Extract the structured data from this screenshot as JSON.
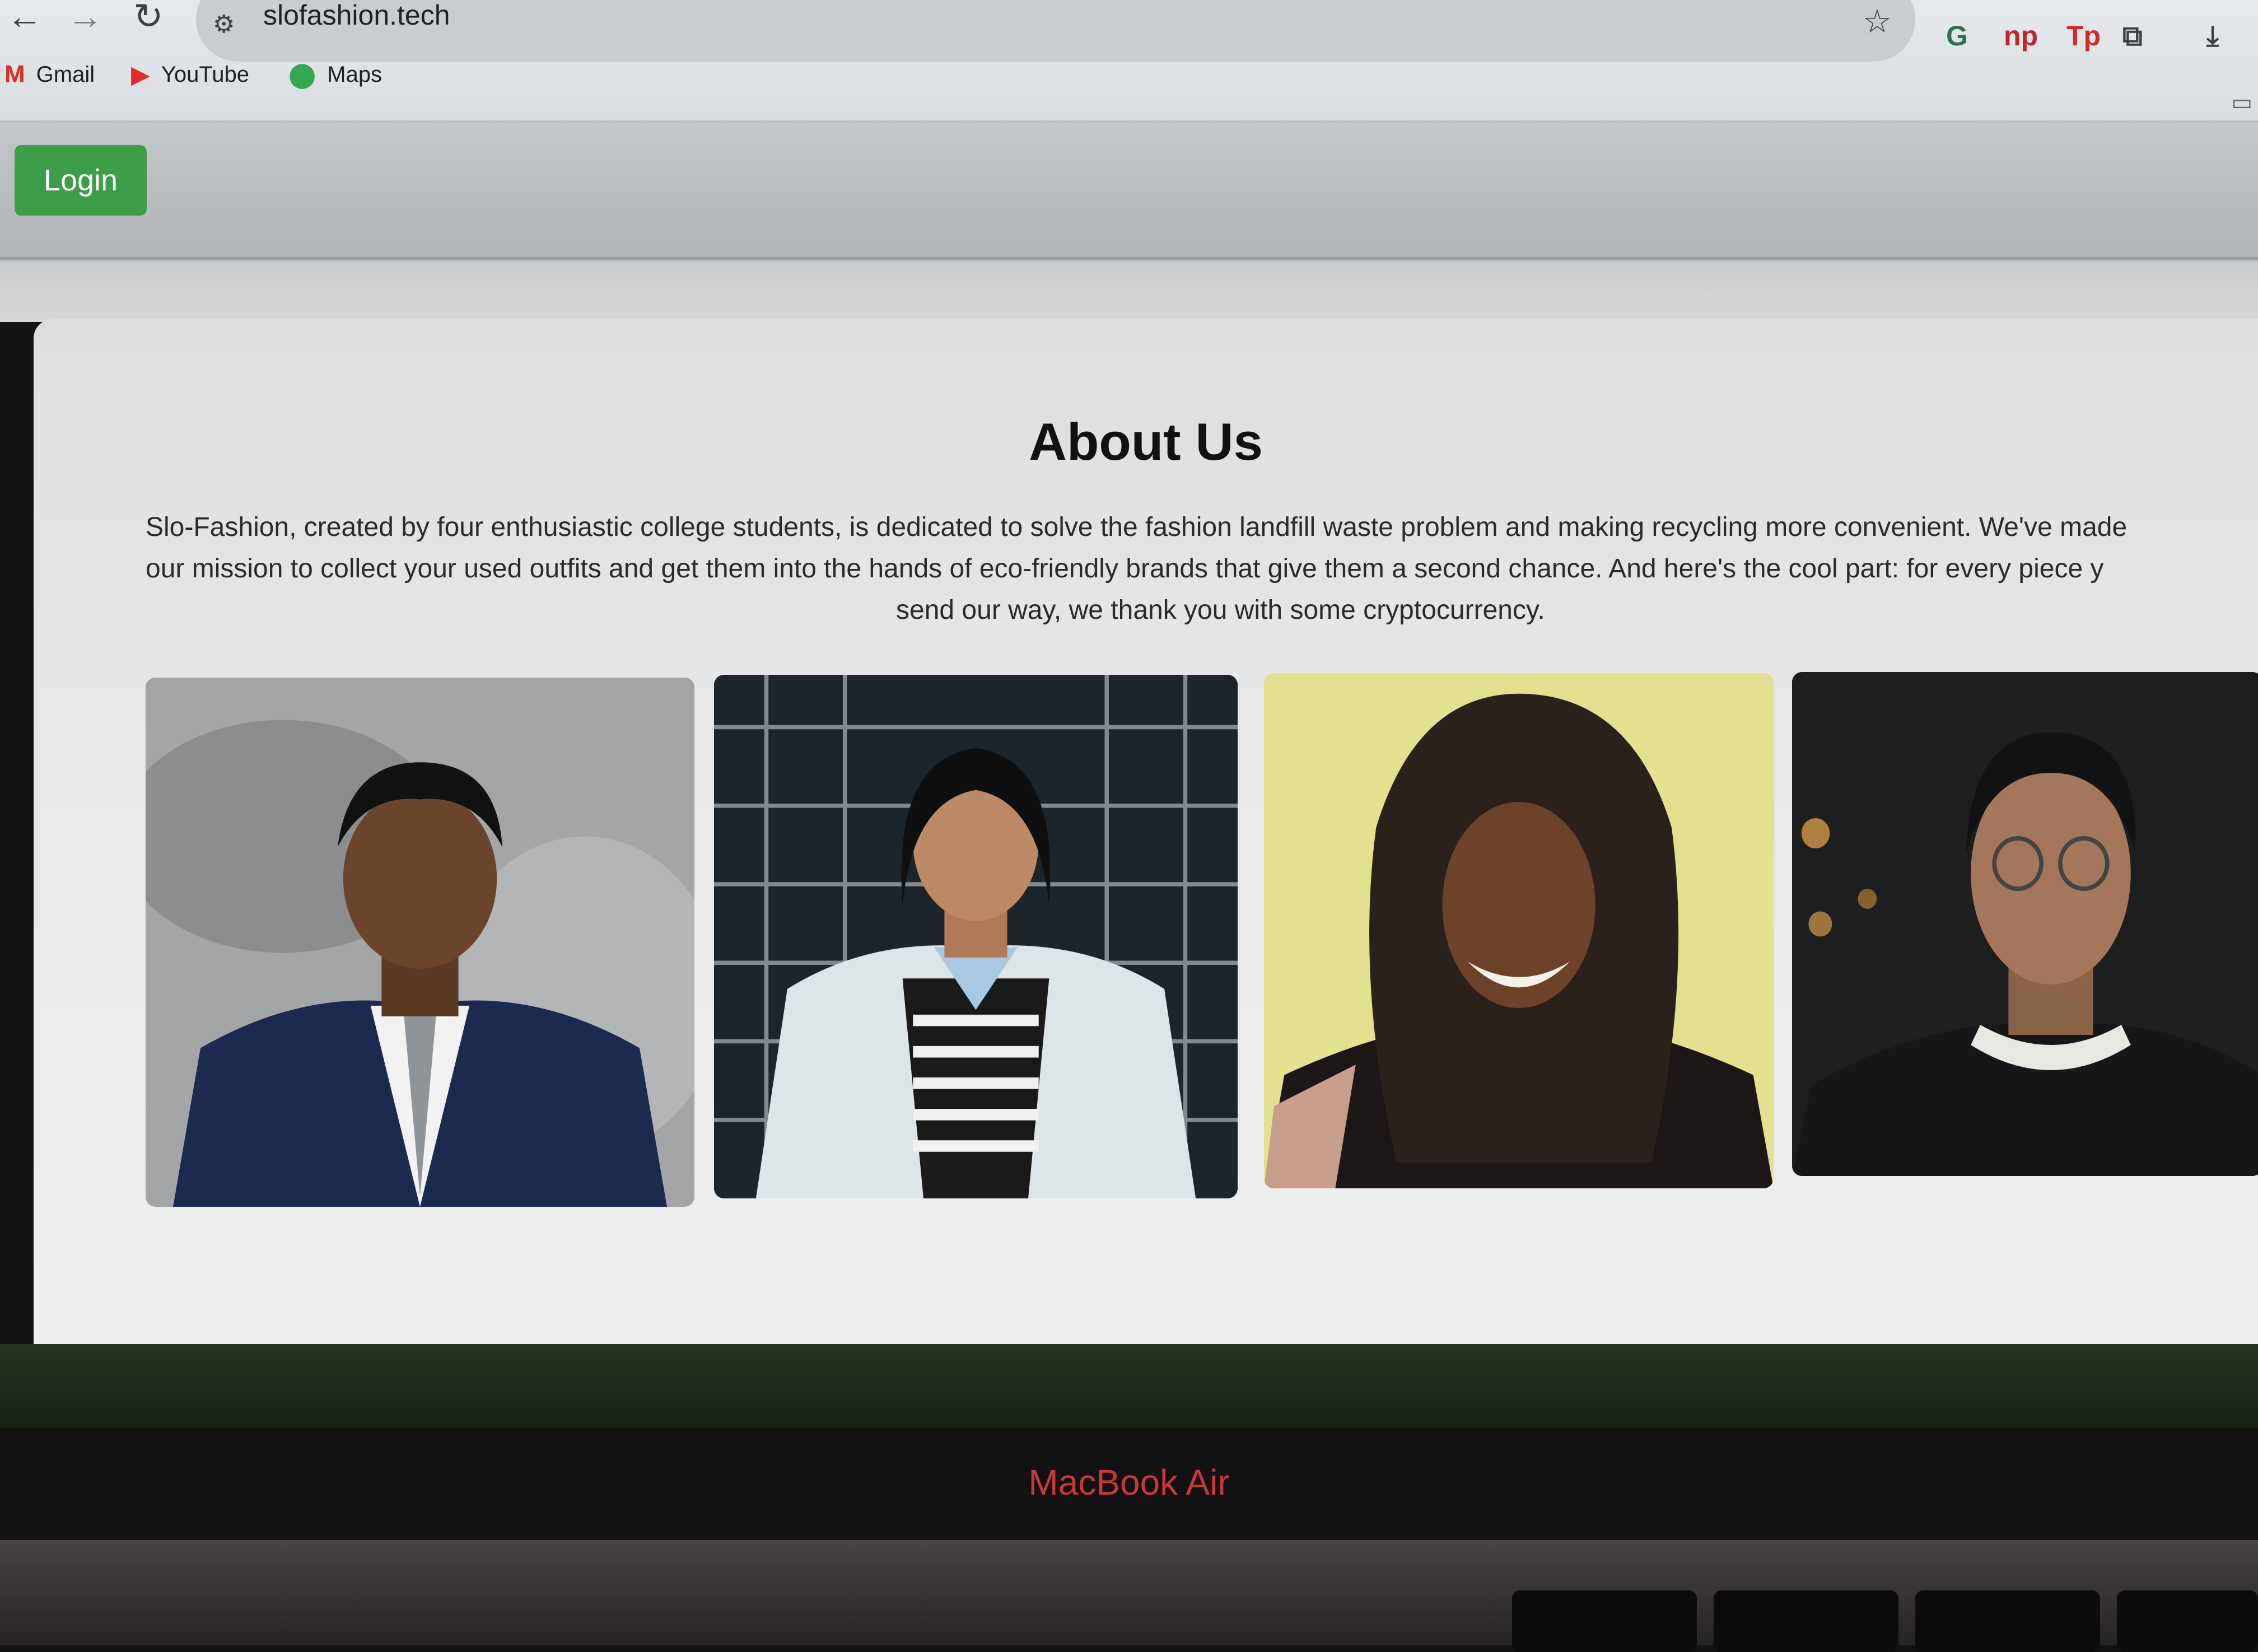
{
  "browser": {
    "url": "slofashion.tech",
    "bookmarks": [
      {
        "label": "Gmail",
        "icon": "gmail-icon"
      },
      {
        "label": "YouTube",
        "icon": "youtube-icon"
      },
      {
        "label": "Maps",
        "icon": "maps-icon"
      }
    ],
    "extensions": [
      "grammarly-icon",
      "np-icon",
      "tp-icon",
      "puzzle-icon"
    ],
    "extension_labels": {
      "np": "np",
      "tp": "Tp"
    }
  },
  "header": {
    "login_label": "Login",
    "login_color": "#3e9e47"
  },
  "about": {
    "title": "About Us",
    "paragraph_lines": [
      "Slo-Fashion, created by four enthusiastic college students, is dedicated to solve the fashion landfill waste problem and making recycling more convenient. We've made",
      "our mission to collect your used outfits and get them into the hands of eco-friendly brands that give them a second chance. And here's the cool part: for every piece y",
      "send our way, we thank you with some cryptocurrency."
    ]
  },
  "team_photos": [
    {
      "name": "team-photo-1",
      "bg": "#9a9b9c"
    },
    {
      "name": "team-photo-2",
      "bg": "#1f2a30"
    },
    {
      "name": "team-photo-3",
      "bg": "#e2df8e"
    },
    {
      "name": "team-photo-4",
      "bg": "#1c1e20"
    }
  ],
  "laptop": {
    "model_label": "MacBook Air"
  }
}
